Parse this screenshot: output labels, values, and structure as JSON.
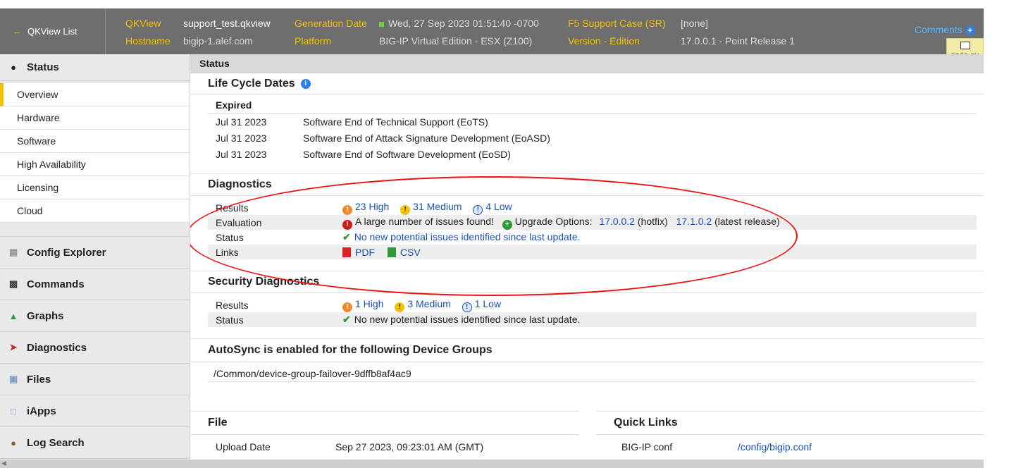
{
  "header": {
    "back_label": "QKView List",
    "qkview_label": "QKView",
    "qkview_value": "support_test.qkview",
    "hostname_label": "Hostname",
    "hostname_value": "bigip-1.alef.com",
    "gen_label": "Generation Date",
    "gen_value": "Wed, 27 Sep 2023 01:51:40 -0700",
    "platform_label": "Platform",
    "platform_value": "BIG-IP Virtual Edition - ESX (Z100)",
    "sr_label": "F5 Support Case (SR)",
    "sr_value": "[none]",
    "version_label": "Version - Edition",
    "version_value": "17.0.0.1 - Point Release 1",
    "comments_label": "Comments",
    "page_guide_label": "page gu"
  },
  "sidebar": {
    "status_label": "Status",
    "items": [
      "Overview",
      "Hardware",
      "Software",
      "High Availability",
      "Licensing",
      "Cloud"
    ],
    "sections": [
      {
        "label": "Config Explorer",
        "icon": "tree-icon"
      },
      {
        "label": "Commands",
        "icon": "terminal-icon"
      },
      {
        "label": "Graphs",
        "icon": "chart-icon"
      },
      {
        "label": "Diagnostics",
        "icon": "pin-icon"
      },
      {
        "label": "Files",
        "icon": "file-icon"
      },
      {
        "label": "iApps",
        "icon": "window-icon"
      },
      {
        "label": "Log Search",
        "icon": "log-icon"
      }
    ]
  },
  "main": {
    "status_bar": "Status",
    "lifecycle": {
      "title": "Life Cycle Dates",
      "group": "Expired",
      "rows": [
        {
          "date": "Jul 31 2023",
          "desc": "Software End of Technical Support (EoTS)"
        },
        {
          "date": "Jul 31 2023",
          "desc": "Software End of Attack Signature Development (EoASD)"
        },
        {
          "date": "Jul 31 2023",
          "desc": "Software End of Software Development (EoSD)"
        }
      ]
    },
    "diagnostics": {
      "title": "Diagnostics",
      "results_label": "Results",
      "high": "23 High",
      "medium": "31 Medium",
      "low": "4 Low",
      "eval_label": "Evaluation",
      "eval_text": "A large number of issues found!",
      "upgrade_label": "Upgrade Options:",
      "upgrade1": "17.0.0.2",
      "upgrade1_note": "(hotfix)",
      "upgrade2": "17.1.0.2",
      "upgrade2_note": "(latest release)",
      "status_label": "Status",
      "status_text": "No new potential issues identified since last update.",
      "links_label": "Links",
      "pdf": "PDF",
      "csv": "CSV"
    },
    "security": {
      "title": "Security Diagnostics",
      "results_label": "Results",
      "high": "1 High",
      "medium": "3 Medium",
      "low": "1 Low",
      "status_label": "Status",
      "status_text": "No new potential issues identified since last update."
    },
    "autosync": {
      "title": "AutoSync is enabled for the following Device Groups",
      "group": "/Common/device-group-failover-9dffb8af4ac9"
    },
    "file": {
      "title": "File",
      "upload_label": "Upload Date",
      "upload_value": "Sep 27 2023, 09:23:01 AM (GMT)"
    },
    "quick_links": {
      "title": "Quick Links",
      "conf_label": "BIG-IP conf",
      "conf_link": "/config/bigip.conf"
    }
  }
}
